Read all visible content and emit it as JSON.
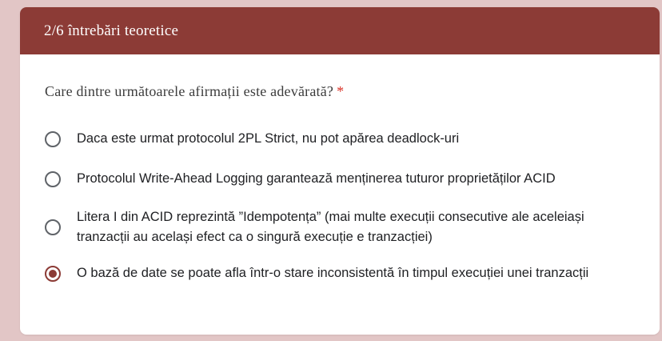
{
  "header": {
    "title": "2/6 întrebări teoretice"
  },
  "question": {
    "text": "Care dintre următoarele afirmații este adevărată?",
    "required_mark": "*"
  },
  "options": [
    {
      "label": "Daca este urmat protocolul 2PL Strict, nu pot apărea deadlock-uri",
      "selected": false
    },
    {
      "label": "Protocolul Write-Ahead Logging garantează menținerea tuturor proprietăților ACID",
      "selected": false
    },
    {
      "label": "Litera I din ACID reprezintă ”Idempotența” (mai multe execuții consecutive ale aceleiași tranzacții au același efect ca o singură execuție e tranzacției)",
      "selected": false
    },
    {
      "label": "O bază de date se poate afla într-o stare inconsistentă în timpul execuției unei tranzacții",
      "selected": true
    }
  ],
  "colors": {
    "accent": "#8c3b36",
    "page_background": "#e2c6c6",
    "required": "#d93025"
  }
}
